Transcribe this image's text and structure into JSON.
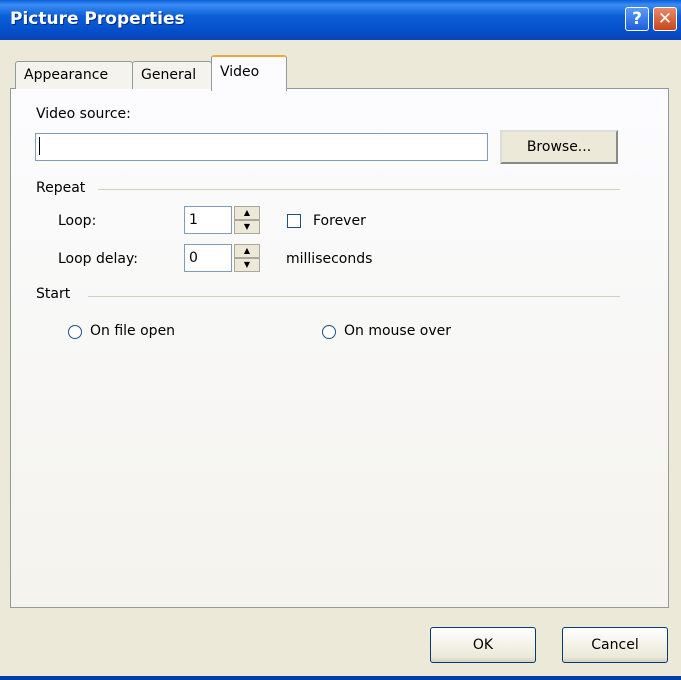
{
  "window": {
    "title": "Picture Properties"
  },
  "titlebar": {
    "help_label": "?",
    "close_label": "✕"
  },
  "tabs": [
    {
      "label": "Appearance"
    },
    {
      "label": "General"
    },
    {
      "label": "Video"
    }
  ],
  "video": {
    "source_label": "Video source:",
    "source_value": "",
    "browse_label": "Browse..."
  },
  "repeat": {
    "group_label": "Repeat",
    "loop_label": "Loop:",
    "loop_value": "1",
    "forever_label": "Forever",
    "forever_checked": false,
    "delay_label": "Loop delay:",
    "delay_value": "0",
    "delay_unit": "milliseconds"
  },
  "start": {
    "group_label": "Start",
    "option_open": "On file open",
    "option_mouse": "On mouse over"
  },
  "footer": {
    "ok_label": "OK",
    "cancel_label": "Cancel"
  }
}
